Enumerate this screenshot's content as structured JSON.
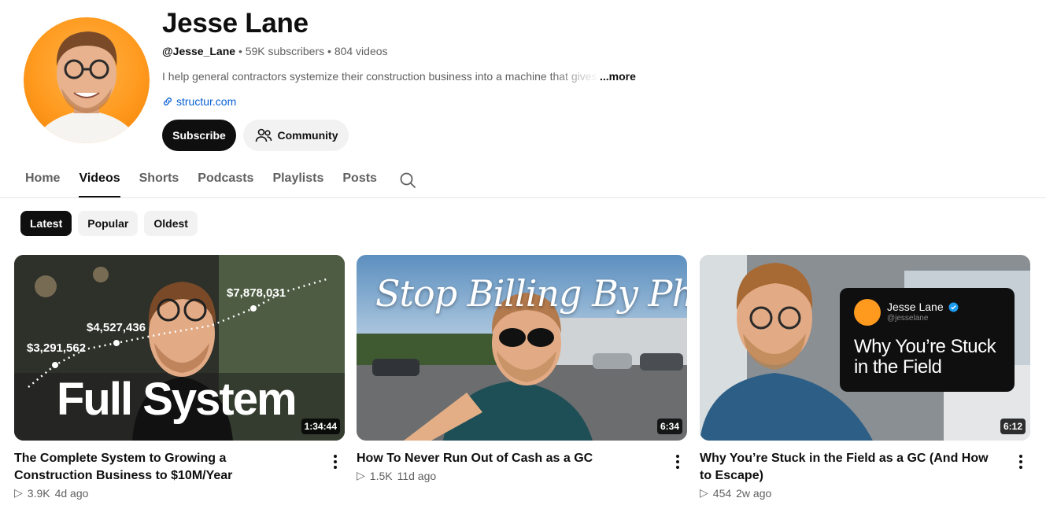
{
  "channel": {
    "name": "Jesse Lane",
    "handle": "@Jesse_Lane",
    "subscribers": "59K subscribers",
    "video_count": "804 videos",
    "separator": "•",
    "description": "I help general contractors systemize their construction business into a machine that gives",
    "more_label": "...more",
    "link": "structur.com",
    "avatar_color": "#ff9a1f"
  },
  "actions": {
    "subscribe_label": "Subscribe",
    "community_label": "Community"
  },
  "tabs": [
    {
      "label": "Home",
      "active": false
    },
    {
      "label": "Videos",
      "active": true
    },
    {
      "label": "Shorts",
      "active": false
    },
    {
      "label": "Podcasts",
      "active": false
    },
    {
      "label": "Playlists",
      "active": false
    },
    {
      "label": "Posts",
      "active": false
    }
  ],
  "chips": [
    {
      "label": "Latest",
      "active": true
    },
    {
      "label": "Popular",
      "active": false
    },
    {
      "label": "Oldest",
      "active": false
    }
  ],
  "videos": [
    {
      "title": "The Complete System to Growing a Construction Business to $10M/Year",
      "views": "3.9K",
      "age": "4d ago",
      "duration": "1:34:44",
      "thumb_text": "Full System",
      "thumb_values": [
        "$3,291,562",
        "$4,527,436",
        "$7,878,031"
      ]
    },
    {
      "title": "How To Never Run Out of Cash as a GC",
      "views": "1.5K",
      "age": "11d ago",
      "duration": "6:34",
      "thumb_text": "Stop Billing By Phase"
    },
    {
      "title": "Why You’re Stuck in the Field as a GC (And How to Escape)",
      "views": "454",
      "age": "2w ago",
      "duration": "6:12",
      "thumb_card_name": "Jesse Lane",
      "thumb_card_handle": "@jesselane",
      "thumb_text": "Why You’re Stuck in the Field"
    }
  ],
  "icons": {
    "search": "search-icon",
    "community": "people-icon",
    "link": "link-icon",
    "play": "play-icon",
    "more": "more-vert-icon"
  },
  "colors": {
    "accent_link": "#065fd4",
    "primary_button": "#0f0f0f",
    "chip_bg": "#f2f2f2"
  }
}
